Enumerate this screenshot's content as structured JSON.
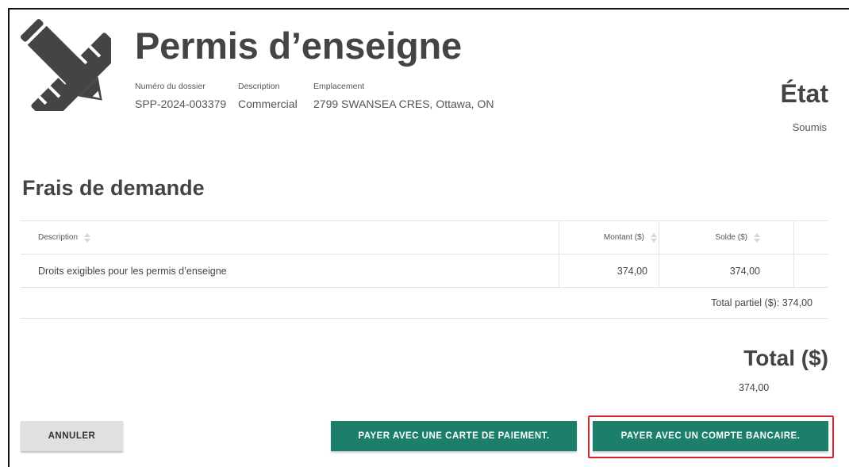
{
  "header": {
    "title": "Permis d’enseigne",
    "logo_icon": "pencil-ruler-icon",
    "fields": [
      {
        "label": "Numéro du dossier",
        "value": "SPP-2024-003379"
      },
      {
        "label": "Description",
        "value": "Commercial"
      },
      {
        "label": "Emplacement",
        "value": "2799 SWANSEA CRES, Ottawa, ON"
      }
    ]
  },
  "status": {
    "title": "État",
    "value": "Soumis"
  },
  "fees": {
    "title": "Frais de demande",
    "columns": [
      "Description",
      "Montant ($)",
      "Solde ($)"
    ],
    "rows": [
      {
        "description": "Droits exigibles pour les permis d’enseigne",
        "amount": "374,00",
        "balance": "374,00"
      }
    ],
    "subtotal": "Total partiel ($): 374,00"
  },
  "total": {
    "title": "Total ($)",
    "value": "374,00"
  },
  "actions": {
    "cancel": "ANNULER",
    "pay_card": "PAYER AVEC UNE CARTE DE PAIEMENT.",
    "pay_bank": "PAYER AVEC UN COMPTE BANCAIRE."
  },
  "colors": {
    "primary_button": "#1b7f6b",
    "highlight": "#d9232a",
    "heading": "#444444"
  }
}
